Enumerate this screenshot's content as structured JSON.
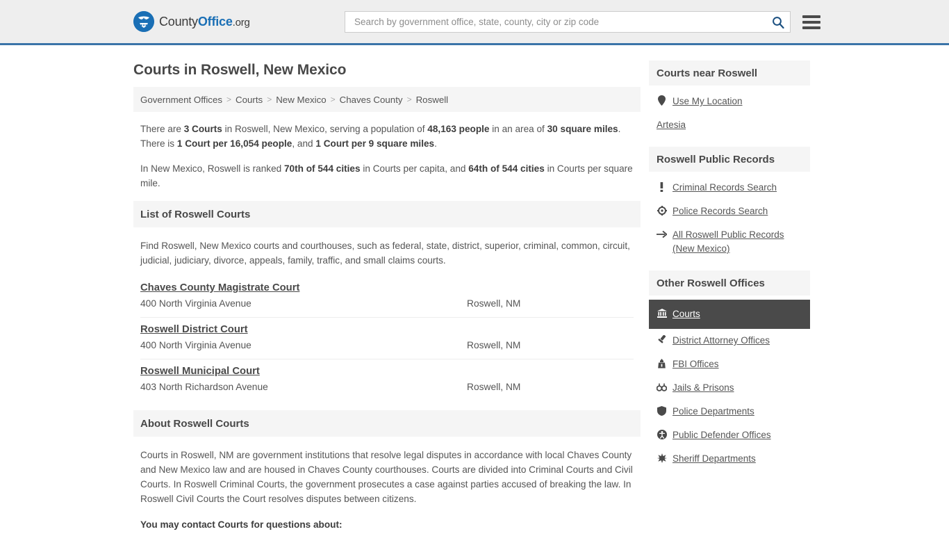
{
  "header": {
    "logo_text_a": "County",
    "logo_text_b": "Office",
    "logo_text_c": ".org",
    "search_placeholder": "Search by government office, state, county, city or zip code",
    "search_value": "",
    "accent_color": "#3a74a8",
    "logo_color": "#1a6fb5"
  },
  "page": {
    "title": "Courts in Roswell, New Mexico"
  },
  "breadcrumb": {
    "items": [
      {
        "label": "Government Offices"
      },
      {
        "label": "Courts"
      },
      {
        "label": "New Mexico"
      },
      {
        "label": "Chaves County"
      },
      {
        "label": "Roswell"
      }
    ],
    "separator": ">"
  },
  "intro": {
    "p1_parts": [
      {
        "t": "There are ",
        "b": false
      },
      {
        "t": "3 Courts",
        "b": true
      },
      {
        "t": " in Roswell, New Mexico, serving a population of ",
        "b": false
      },
      {
        "t": "48,163 people",
        "b": true
      },
      {
        "t": " in an area of ",
        "b": false
      },
      {
        "t": "30 square miles",
        "b": true
      },
      {
        "t": ". There is ",
        "b": false
      },
      {
        "t": "1 Court per 16,054 people",
        "b": true
      },
      {
        "t": ", and ",
        "b": false
      },
      {
        "t": "1 Court per 9 square miles",
        "b": true
      },
      {
        "t": ".",
        "b": false
      }
    ],
    "p2_parts": [
      {
        "t": "In New Mexico, Roswell is ranked ",
        "b": false
      },
      {
        "t": "70th of 544 cities",
        "b": true
      },
      {
        "t": " in Courts per capita, and ",
        "b": false
      },
      {
        "t": "64th of 544 cities",
        "b": true
      },
      {
        "t": " in Courts per square mile.",
        "b": false
      }
    ]
  },
  "list_section": {
    "heading": "List of Roswell Courts",
    "description": "Find Roswell, New Mexico courts and courthouses, such as federal, state, district, superior, criminal, common, circuit, judicial, judiciary, divorce, appeals, family, traffic, and small claims courts.",
    "courts": [
      {
        "name": "Chaves County Magistrate Court",
        "address": "400 North Virginia Avenue",
        "city": "Roswell, NM"
      },
      {
        "name": "Roswell District Court",
        "address": "400 North Virginia Avenue",
        "city": "Roswell, NM"
      },
      {
        "name": "Roswell Municipal Court",
        "address": "403 North Richardson Avenue",
        "city": "Roswell, NM"
      }
    ]
  },
  "about_section": {
    "heading": "About Roswell Courts",
    "paragraph": "Courts in Roswell, NM are government institutions that resolve legal disputes in accordance with local Chaves County and New Mexico law and are housed in Chaves County courthouses. Courts are divided into Criminal Courts and Civil Courts. In Roswell Criminal Courts, the government prosecutes a case against parties accused of breaking the law. In Roswell Civil Courts the Court resolves disputes between citizens.",
    "contact_lead": "You may contact Courts for questions about:"
  },
  "sidebar": {
    "blocks": [
      {
        "heading": "Courts near Roswell",
        "items": [
          {
            "label": "Use My Location",
            "icon": "map-pin-icon"
          },
          {
            "label": "Artesia",
            "icon": ""
          }
        ]
      },
      {
        "heading": "Roswell Public Records",
        "items": [
          {
            "label": "Criminal Records Search",
            "icon": "exclamation-icon"
          },
          {
            "label": "Police Records Search",
            "icon": "crosshair-icon"
          },
          {
            "label": "All Roswell Public Records (New Mexico)",
            "icon": "arrow-right-icon"
          }
        ]
      },
      {
        "heading": "Other Roswell Offices",
        "items": [
          {
            "label": "Courts",
            "icon": "courthouse-icon",
            "active": true
          },
          {
            "label": "District Attorney Offices",
            "icon": "gavel-icon"
          },
          {
            "label": "FBI Offices",
            "icon": "fbi-badge-icon"
          },
          {
            "label": "Jails & Prisons",
            "icon": "handcuffs-icon"
          },
          {
            "label": "Police Departments",
            "icon": "shield-icon"
          },
          {
            "label": "Public Defender Offices",
            "icon": "accessibility-icon"
          },
          {
            "label": "Sheriff Departments",
            "icon": "star-badge-icon"
          }
        ]
      }
    ]
  }
}
